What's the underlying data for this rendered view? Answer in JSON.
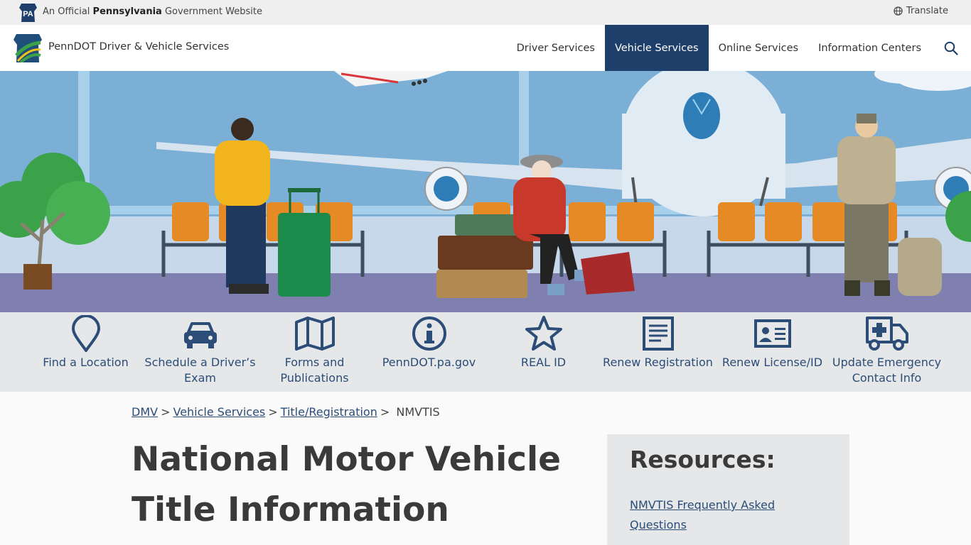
{
  "gov_bar": {
    "badge": "PA",
    "prefix": "An Official ",
    "state": "Pennsylvania",
    "suffix": " Government Website",
    "translate": "Translate"
  },
  "header": {
    "site_title": "PennDOT Driver & Vehicle Services",
    "nav": [
      "Driver Services",
      "Vehicle Services",
      "Online Services",
      "Information Centers"
    ],
    "active_nav": "Vehicle Services"
  },
  "quick_links": [
    {
      "label": "Find a Location",
      "icon": "map-pin-icon"
    },
    {
      "label": "Schedule a Driver’s Exam",
      "icon": "car-icon"
    },
    {
      "label": "Forms and Publications",
      "icon": "map-icon"
    },
    {
      "label": "PennDOT.pa.gov",
      "icon": "info-icon"
    },
    {
      "label": "REAL ID",
      "icon": "star-icon"
    },
    {
      "label": "Renew Registration",
      "icon": "document-icon"
    },
    {
      "label": "Renew License/ID",
      "icon": "id-card-icon"
    },
    {
      "label": "Update Emergency Contact Info",
      "icon": "ambulance-icon"
    }
  ],
  "breadcrumb": {
    "items": [
      "DMV",
      "Vehicle Services",
      "Title/Registration"
    ],
    "current": "NMVTIS",
    "separator": ">"
  },
  "page": {
    "title": "National Motor Vehicle Title Information"
  },
  "resources": {
    "title": "Resources:",
    "links": [
      "NMVTIS Frequently Asked Questions"
    ]
  },
  "colors": {
    "brand_blue": "#1f3f6b",
    "link_blue": "#2b4d78",
    "hero_sky": "#7bafd6",
    "hero_floor": "#7f80b0"
  }
}
